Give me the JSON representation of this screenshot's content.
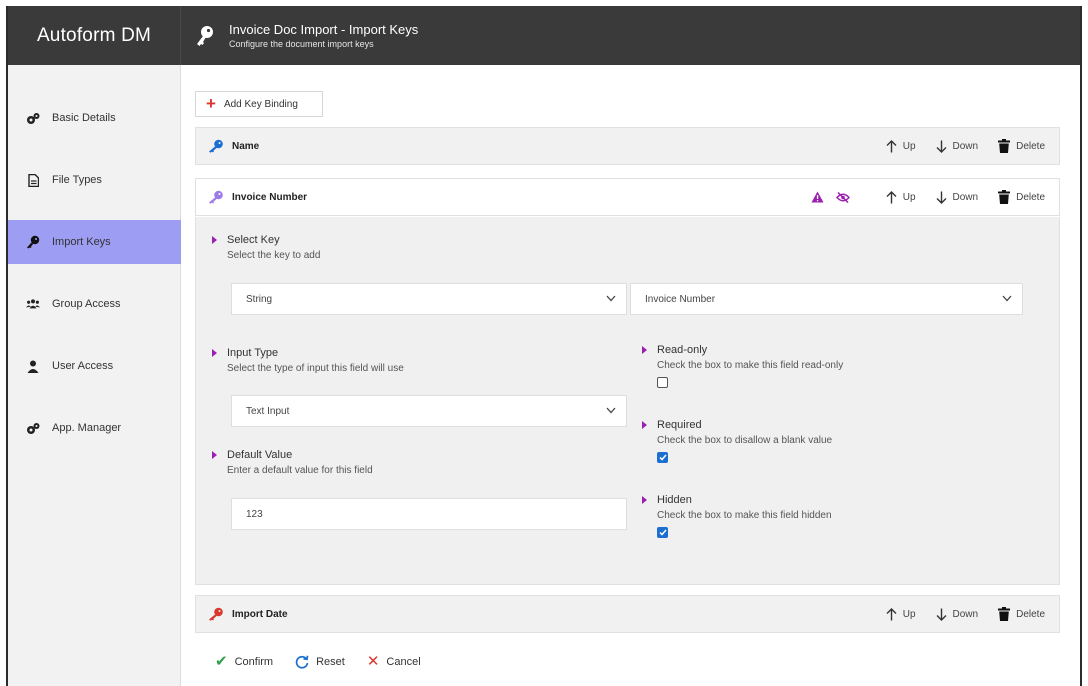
{
  "app": {
    "name": "Autoform DM"
  },
  "header": {
    "title": "Invoice Doc Import - Import Keys",
    "subtitle": "Configure the document import keys"
  },
  "sidebar": {
    "items": [
      {
        "label": "Basic Details",
        "icon": "cogs-icon",
        "active": false
      },
      {
        "label": "File Types",
        "icon": "file-icon",
        "active": false
      },
      {
        "label": "Import Keys",
        "icon": "key-icon",
        "active": true
      },
      {
        "label": "Group Access",
        "icon": "group-icon",
        "active": false
      },
      {
        "label": "User Access",
        "icon": "user-icon",
        "active": false
      },
      {
        "label": "App. Manager",
        "icon": "cogs-icon",
        "active": false
      }
    ]
  },
  "toolbar": {
    "add_label": "Add Key Binding"
  },
  "actions": {
    "up": "Up",
    "down": "Down",
    "delete": "Delete"
  },
  "keys": [
    {
      "name": "Name",
      "icon_color": "#1a6fd0"
    },
    {
      "name": "Invoice Number",
      "icon_color": "#9d7be8"
    },
    {
      "name": "Import Date",
      "icon_color": "#d9382d"
    }
  ],
  "detail": {
    "select_key": {
      "title": "Select Key",
      "desc": "Select the key to add",
      "type_value": "String",
      "key_value": "Invoice Number"
    },
    "input_type": {
      "title": "Input Type",
      "desc": "Select the type of input this field will use",
      "value": "Text Input"
    },
    "default_value": {
      "title": "Default Value",
      "desc": "Enter a default value for this field",
      "value": "123"
    },
    "read_only": {
      "title": "Read-only",
      "desc": "Check the box to make this field read-only",
      "checked": false
    },
    "required": {
      "title": "Required",
      "desc": "Check the box to disallow a blank value",
      "checked": true
    },
    "hidden": {
      "title": "Hidden",
      "desc": "Check the box to make this field hidden",
      "checked": true
    }
  },
  "footer": {
    "confirm": "Confirm",
    "reset": "Reset",
    "cancel": "Cancel"
  },
  "colors": {
    "accent": "#9d9df3",
    "purple": "#9b1fb0",
    "checkbox": "#1a6fd0"
  }
}
